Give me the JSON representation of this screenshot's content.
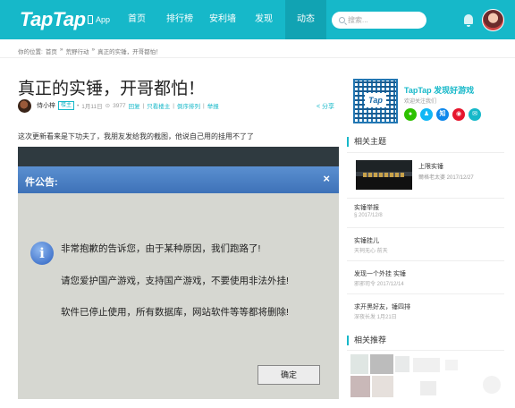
{
  "nav": {
    "logo": "TapTap",
    "app_label": "App",
    "items": [
      "首页",
      "排行榜",
      "安利墙",
      "发现",
      "动态"
    ],
    "active_index": 4,
    "search_placeholder": "搜索..."
  },
  "breadcrumb": {
    "label": "你的位置:",
    "items": [
      "首页",
      "»",
      "荒野行动",
      "»",
      "真正的实锤，开哥都怕！"
    ]
  },
  "post": {
    "title": "真正的实锤，开哥都怕！",
    "author": "侍小梓",
    "author_tag": "楼主",
    "date": "1月11日",
    "views": "3977",
    "links": [
      "回复",
      "只看楼主",
      "倒序排列",
      "举报"
    ],
    "separators": [
      "|",
      "|",
      "|"
    ],
    "share_label": "分享",
    "body": "这次更新看来是下功夫了，我朋友发给我的截图，他说自己用的挂用不了了"
  },
  "dialog": {
    "title": "件公告:",
    "close": "×",
    "lines": [
      "非常抱歉的告诉您，由于某种原因，我们跑路了!",
      "请您爱护国产游戏，支持国产游戏，不要使用非法外挂!",
      "软件已停止使用，所有数据库，网站软件等等都将删除!"
    ],
    "ok_label": "确定"
  },
  "sidebar": {
    "promo_title": "TapTap 发现好游戏",
    "promo_sub": "欢迎关注我们",
    "qr_logo": "Tap",
    "socials": [
      {
        "icon": "wechat-icon",
        "color": "#2dc100",
        "glyph": "●"
      },
      {
        "icon": "qq-icon",
        "color": "#12b7f5",
        "glyph": "♟"
      },
      {
        "icon": "zhihu-icon",
        "color": "#0f88eb",
        "glyph": "知"
      },
      {
        "icon": "weibo-icon",
        "color": "#e6162d",
        "glyph": "◉"
      },
      {
        "icon": "mail-icon",
        "color": "#16b8c9",
        "glyph": "✉"
      }
    ],
    "related_title": "相关主题",
    "featured": {
      "title": "上限实锤",
      "meta": "爾格老太婆  2017/12/27"
    },
    "related": [
      {
        "title": "实锤举报",
        "meta": "§  2017/12/8"
      },
      {
        "title": "实锤挂儿",
        "meta": "天祠无心  前天"
      },
      {
        "title": "发现一个外挂 实锤",
        "meta": "邪邪司令  2017/12/14"
      },
      {
        "title": "求开黑好友，锤四排",
        "meta": "深夜长发  1月21日"
      }
    ],
    "recommend_title": "相关推荐"
  }
}
